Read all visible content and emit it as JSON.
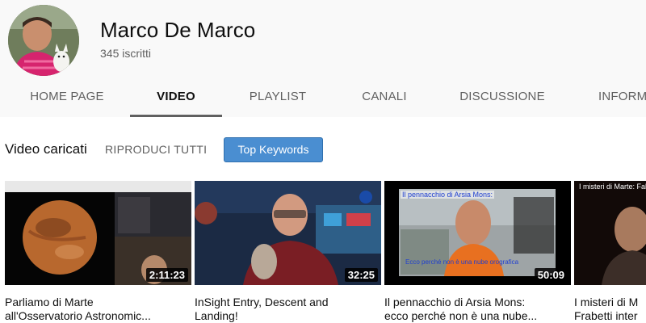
{
  "channel": {
    "name": "Marco De Marco",
    "subscribers": "345 iscritti"
  },
  "tabs": [
    {
      "label": "HOME PAGE"
    },
    {
      "label": "VIDEO"
    },
    {
      "label": "PLAYLIST"
    },
    {
      "label": "CANALI"
    },
    {
      "label": "DISCUSSIONE"
    },
    {
      "label": "INFORMAZIONI"
    }
  ],
  "active_tab": "VIDEO",
  "section": {
    "title": "Video caricati",
    "play_all": "RIPRODUCI TUTTI",
    "keywords_button": "Top Keywords"
  },
  "videos": [
    {
      "title": "Parliamo di Marte\nall'Osservatorio Astronomic...",
      "duration": "2:11:23"
    },
    {
      "title": "InSight Entry, Descent and\nLanding!",
      "duration": "32:25"
    },
    {
      "title": "Il pennacchio di Arsia Mons:\necco perché non è una nube...",
      "duration": "50:09",
      "overlay_top": "Il pennacchio di Arsia Mons:",
      "overlay_bottom": "Ecco perché non è una nube orografica"
    },
    {
      "title": "I misteri di M\nFrabetti inter",
      "overlay_top": "I misteri di Marte: Fab"
    }
  ],
  "colors": {
    "accent_button": "#4a8ed1",
    "header_bg": "#f9f9f9",
    "tab_underline": "#606060"
  }
}
